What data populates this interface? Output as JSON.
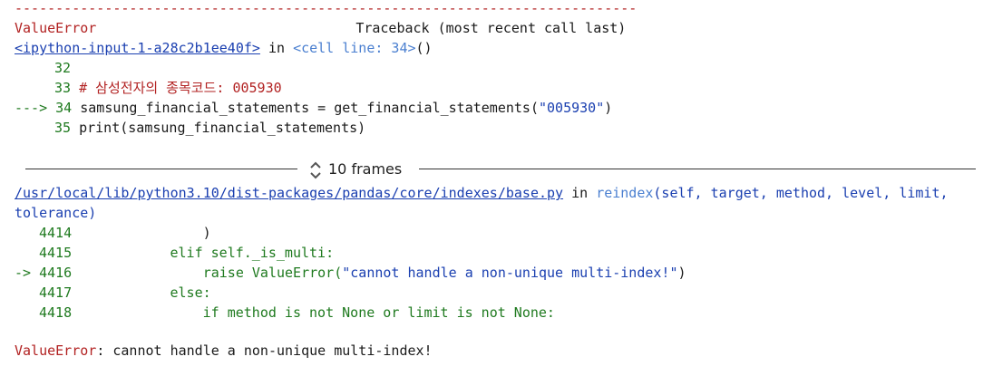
{
  "top_rule": "----------------------------------------------------------------------------",
  "error_header": {
    "name": "ValueError",
    "traceback": "Traceback (most recent call last)"
  },
  "frame1": {
    "link": "<ipython-input-1-a28c2b1ee40f>",
    "in": " in ",
    "location": "<cell line: 34>",
    "paren": "()",
    "lines": [
      {
        "num": "32",
        "arrow": "",
        "code": ""
      },
      {
        "num": "33",
        "arrow": "",
        "code": "# 삼성전자의 종목코드: 005930"
      },
      {
        "num": "34",
        "arrow": "---> ",
        "code_a": "samsung_financial_statements = get_financial_statements(",
        "code_b": "\"005930\"",
        "code_c": ")"
      },
      {
        "num": "35",
        "arrow": "",
        "code_a": "print",
        "code_b": "(samsung_financial_statements)"
      }
    ]
  },
  "frames_toggle": "10 frames",
  "frame2": {
    "path": "/usr/local/lib/python3.10/dist-packages/pandas/core/indexes/base.py",
    "in": " in ",
    "func": "reindex",
    "args": "(self, target, method, level, limit,",
    "args_cont": "tolerance)",
    "lines": [
      {
        "num": "4414",
        "code": "                )"
      },
      {
        "num": "4415",
        "code": "            elif self._is_multi:"
      },
      {
        "num": "4416",
        "arrow": "-> ",
        "code_a": "                raise ValueError(",
        "code_b": "\"cannot handle a non-unique multi-index!\"",
        "code_c": ")"
      },
      {
        "num": "4417",
        "code": "            else:"
      },
      {
        "num": "4418",
        "code": "                if method is not None or limit is not None:"
      }
    ]
  },
  "final_error": {
    "name": "ValueError",
    "message": ": cannot handle a non-unique multi-index!"
  }
}
